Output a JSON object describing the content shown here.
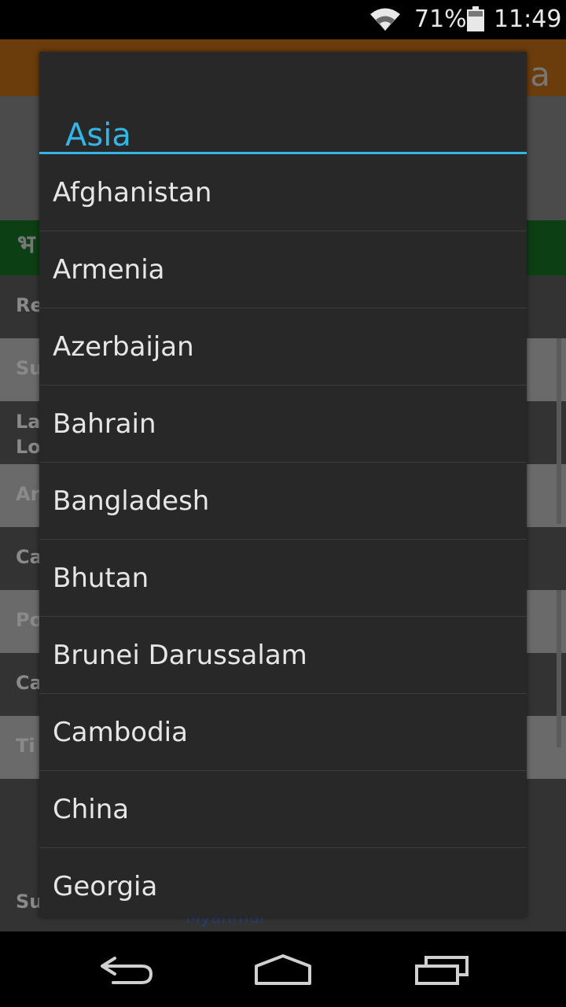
{
  "status_bar": {
    "battery_percent": "71%",
    "time": "11:49",
    "icons": [
      "wifi-icon",
      "battery-icon"
    ]
  },
  "background_app": {
    "title_fragment": "a",
    "green_band_fragment": "भ",
    "rows": [
      {
        "label": "Re"
      },
      {
        "label": "Su"
      },
      {
        "label": "La\nLo"
      },
      {
        "label": "Ar"
      },
      {
        "label": "Ca"
      },
      {
        "label": "Po"
      },
      {
        "label": "Ca"
      },
      {
        "label": "Ti"
      },
      {
        "label": "Su"
      }
    ],
    "bottom_fragment": "Myanmar"
  },
  "dialog": {
    "title": "Asia",
    "accent_color": "#33b5e5",
    "items": [
      "Afghanistan",
      "Armenia",
      "Azerbaijan",
      "Bahrain",
      "Bangladesh",
      "Bhutan",
      "Brunei Darussalam",
      "Cambodia",
      "China",
      "Georgia"
    ]
  },
  "nav_bar": {
    "icons": [
      "back-icon",
      "home-icon",
      "recent-apps-icon"
    ]
  }
}
